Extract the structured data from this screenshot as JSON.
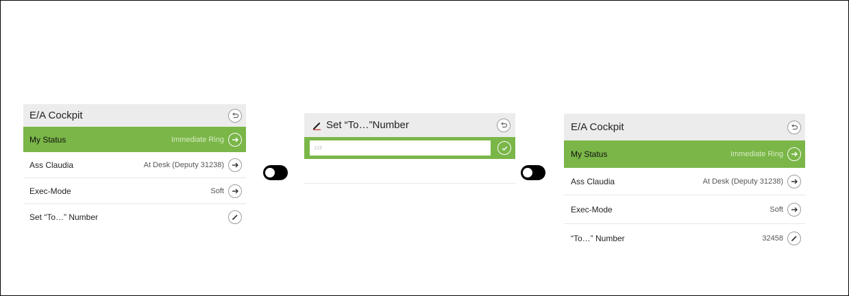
{
  "colors": {
    "accent": "#7ab648",
    "header_bg": "#ececec",
    "toggle": "#000000"
  },
  "panel_left": {
    "title": "E/A Cockpit",
    "back_icon": "back-arrow-icon",
    "rows": [
      {
        "label": "My Status",
        "value": "Immediate Ring",
        "icon": "arrow-right-icon",
        "active": true
      },
      {
        "label": "Ass Claudia",
        "value": "At Desk (Deputy 31238)",
        "icon": "arrow-right-icon"
      },
      {
        "label": "Exec-Mode",
        "value": "Soft",
        "icon": "arrow-right-icon"
      },
      {
        "label": "Set “To…” Number",
        "value": "",
        "icon": "pencil-icon"
      }
    ]
  },
  "panel_middle": {
    "title": "Set “To…”Number",
    "title_icon": "pencil-icon",
    "back_icon": "back-arrow-icon",
    "input_placeholder": "123",
    "confirm_icon": "checkmark-icon"
  },
  "panel_right": {
    "title": "E/A Cockpit",
    "back_icon": "back-arrow-icon",
    "rows": [
      {
        "label": "My Status",
        "value": "Immediate Ring",
        "icon": "arrow-right-icon",
        "active": true
      },
      {
        "label": "Ass Claudia",
        "value": "At Desk (Deputy 31238)",
        "icon": "arrow-right-icon"
      },
      {
        "label": "Exec-Mode",
        "value": "Soft",
        "icon": "arrow-right-icon"
      },
      {
        "label": "“To…” Number",
        "value": "32458",
        "icon": "pencil-icon"
      }
    ]
  },
  "toggles": [
    {
      "name": "toggle-1",
      "state": "off"
    },
    {
      "name": "toggle-2",
      "state": "off"
    }
  ]
}
